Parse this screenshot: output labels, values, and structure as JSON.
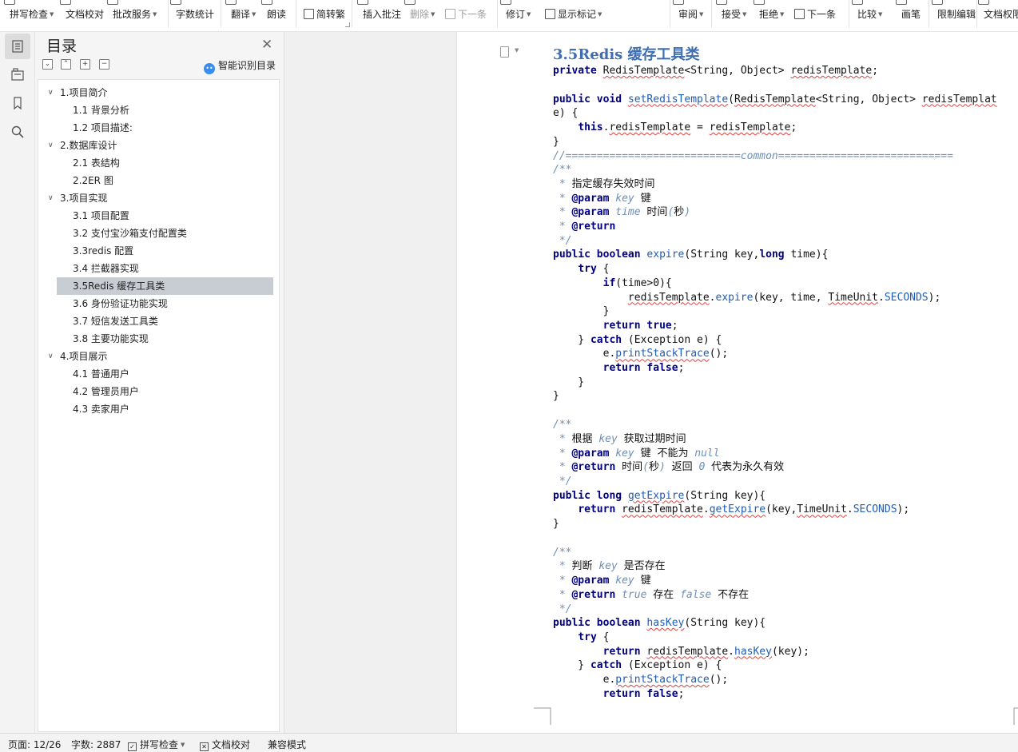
{
  "ribbon": {
    "items": [
      {
        "label": "拼写检查",
        "caret": true,
        "icon": "spellcheck-icon"
      },
      {
        "label": "文档校对",
        "caret": false,
        "icon": "proofread-icon"
      },
      {
        "label": "批改服务",
        "caret": true,
        "icon": "correction-service-icon"
      },
      {
        "label": "字数统计",
        "caret": false,
        "icon": "word-count-icon"
      },
      {
        "label": "翻译",
        "caret": true,
        "icon": "translate-icon"
      },
      {
        "label": "朗读",
        "caret": false,
        "icon": "read-aloud-icon"
      },
      {
        "label": "简转繁",
        "caret": false,
        "icon": "simplified-traditional-icon"
      },
      {
        "label": "插入批注",
        "caret": false,
        "icon": "insert-comment-icon"
      },
      {
        "label": "删除",
        "caret": true,
        "icon": "delete-comment-icon"
      },
      {
        "label": "下一条",
        "caret": false,
        "icon": "next-comment-icon"
      },
      {
        "label": "修订",
        "caret": true,
        "icon": "track-changes-icon"
      },
      {
        "label": "显示标记",
        "caret": true,
        "icon": "show-markup-icon"
      },
      {
        "label": "审阅",
        "caret": true,
        "icon": "review-pane-icon"
      },
      {
        "label": "接受",
        "caret": true,
        "icon": "accept-icon"
      },
      {
        "label": "拒绝",
        "caret": true,
        "icon": "reject-icon"
      },
      {
        "label": "下一条",
        "caret": false,
        "icon": "next-change-icon"
      },
      {
        "label": "比较",
        "caret": true,
        "icon": "compare-icon"
      },
      {
        "label": "画笔",
        "caret": false,
        "icon": "pen-icon"
      },
      {
        "label": "限制编辑",
        "caret": false,
        "icon": "restrict-editing-icon"
      },
      {
        "label": "文档权限",
        "caret": false,
        "icon": "document-permission-icon"
      }
    ]
  },
  "sidebar_icons": [
    "toc-icon",
    "navigation-icon",
    "bookmark-icon",
    "search-icon"
  ],
  "toc": {
    "title": "目录",
    "smart_label": "智能识别目录",
    "items": [
      {
        "label": "1.项目简介",
        "level": 1,
        "expanded": true
      },
      {
        "label": "1.1 背景分析",
        "level": 2
      },
      {
        "label": "1.2 项目描述:",
        "level": 2
      },
      {
        "label": "2.数据库设计",
        "level": 1,
        "expanded": true
      },
      {
        "label": "2.1 表结构",
        "level": 2
      },
      {
        "label": "2.2ER 图",
        "level": 2
      },
      {
        "label": "3.项目实现",
        "level": 1,
        "expanded": true
      },
      {
        "label": "3.1 项目配置",
        "level": 2
      },
      {
        "label": "3.2 支付宝沙箱支付配置类",
        "level": 2
      },
      {
        "label": "3.3redis 配置",
        "level": 2
      },
      {
        "label": "3.4 拦截器实现",
        "level": 2
      },
      {
        "label": "3.5Redis 缓存工具类",
        "level": 2,
        "selected": true
      },
      {
        "label": "3.6 身份验证功能实现",
        "level": 2
      },
      {
        "label": "3.7 短信发送工具类",
        "level": 2
      },
      {
        "label": "3.8 主要功能实现",
        "level": 2
      },
      {
        "label": "4.项目展示",
        "level": 1,
        "expanded": true
      },
      {
        "label": "4.1 普通用户",
        "level": 2
      },
      {
        "label": "4.2 管理员用户",
        "level": 2
      },
      {
        "label": "4.3 卖家用户",
        "level": 2
      }
    ]
  },
  "document": {
    "heading": "3.5Redis 缓存工具类",
    "code_lines": [
      "private RedisTemplate<String, Object> redisTemplate;",
      "",
      "public void setRedisTemplate(RedisTemplate<String, Object> redisTemplat",
      "e) {",
      "    this.redisTemplate = redisTemplate;",
      "}",
      "//============================common============================",
      "/**",
      " * 指定缓存失效时间",
      " * @param key 键",
      " * @param time 时间(秒)",
      " * @return",
      " */",
      "public boolean expire(String key,long time){",
      "    try {",
      "        if(time>0){",
      "            redisTemplate.expire(key, time, TimeUnit.SECONDS);",
      "        }",
      "        return true;",
      "    } catch (Exception e) {",
      "        e.printStackTrace();",
      "        return false;",
      "    }",
      "}",
      "",
      "/**",
      " * 根据 key 获取过期时间",
      " * @param key 键 不能为 null",
      " * @return 时间(秒) 返回 0 代表为永久有效",
      " */",
      "public long getExpire(String key){",
      "    return redisTemplate.getExpire(key,TimeUnit.SECONDS);",
      "}",
      "",
      "/**",
      " * 判断 key 是否存在",
      " * @param key 键",
      " * @return true 存在 false 不存在",
      " */",
      "public boolean hasKey(String key){",
      "    try {",
      "        return redisTemplate.hasKey(key);",
      "    } catch (Exception e) {",
      "        e.printStackTrace();",
      "        return false;"
    ]
  },
  "status": {
    "page": "页面: 12/26",
    "words": "字数: 2887",
    "spellcheck": "拼写检查",
    "proofread": "文档校对",
    "compat": "兼容模式"
  },
  "colors": {
    "heading": "#3f6fb2",
    "keyword": "#000080",
    "method": "#1f5cb5",
    "comment": "#6f8fb5",
    "toc_selected": "#c8cdd3"
  }
}
